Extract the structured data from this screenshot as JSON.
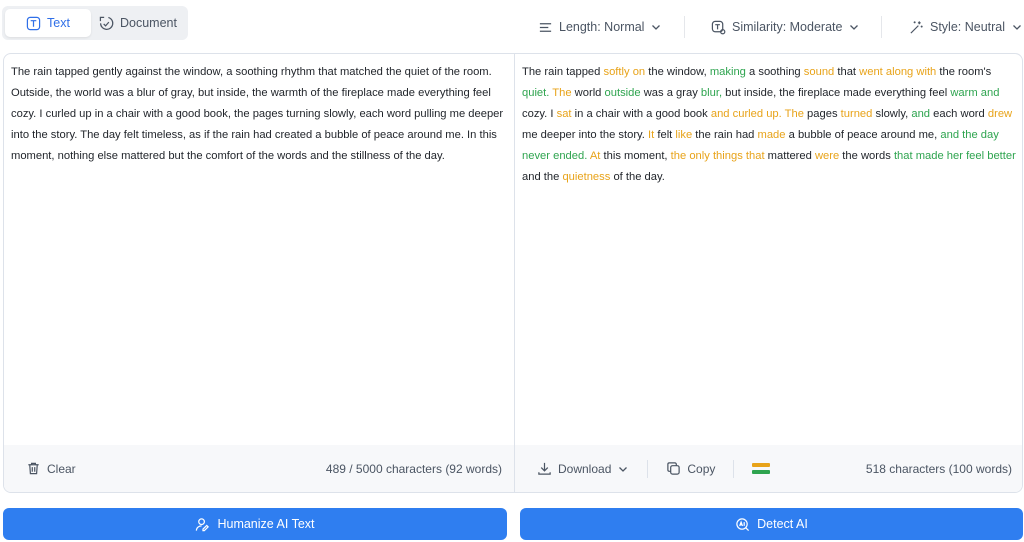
{
  "modes": {
    "text_label": "Text",
    "document_label": "Document"
  },
  "options": {
    "length_label": "Length: Normal",
    "similarity_label": "Similarity: Moderate",
    "style_label": "Style: Neutral"
  },
  "input": {
    "text": "The rain tapped gently against the window, a soothing rhythm that matched the quiet of the room. Outside, the world was a blur of gray, but inside, the warmth of the fireplace made everything feel cozy. I curled up in a chair with a good book, the pages turning slowly, each word pulling me deeper into the story. The day felt timeless, as if the rain had created a bubble of peace around me. In this moment, nothing else mattered but the comfort of the words and the stillness of the day.",
    "clear_label": "Clear",
    "count_label": "489 / 5000 characters (92 words)"
  },
  "output": {
    "segments": [
      {
        "t": "The rain tapped ",
        "c": "n"
      },
      {
        "t": "softly on",
        "c": "o"
      },
      {
        "t": " the window, ",
        "c": "n"
      },
      {
        "t": "making",
        "c": "g"
      },
      {
        "t": " a soothing ",
        "c": "n"
      },
      {
        "t": "sound",
        "c": "o"
      },
      {
        "t": " that ",
        "c": "n"
      },
      {
        "t": "went along with",
        "c": "o"
      },
      {
        "t": " the room's ",
        "c": "n"
      },
      {
        "t": "quiet.",
        "c": "g"
      },
      {
        "t": " ",
        "c": "n"
      },
      {
        "t": "The",
        "c": "o"
      },
      {
        "t": " world ",
        "c": "n"
      },
      {
        "t": "outside",
        "c": "g"
      },
      {
        "t": " was a gray ",
        "c": "n"
      },
      {
        "t": "blur,",
        "c": "g"
      },
      {
        "t": " but inside, the fireplace made everything feel ",
        "c": "n"
      },
      {
        "t": "warm and",
        "c": "g"
      },
      {
        "t": " cozy. I ",
        "c": "n"
      },
      {
        "t": "sat",
        "c": "o"
      },
      {
        "t": " in a chair with a good book ",
        "c": "n"
      },
      {
        "t": "and curled up. The",
        "c": "o"
      },
      {
        "t": " pages ",
        "c": "n"
      },
      {
        "t": "turned",
        "c": "o"
      },
      {
        "t": " slowly, ",
        "c": "n"
      },
      {
        "t": "and",
        "c": "g"
      },
      {
        "t": " each word ",
        "c": "n"
      },
      {
        "t": "drew",
        "c": "o"
      },
      {
        "t": " me deeper into the story. ",
        "c": "n"
      },
      {
        "t": "It",
        "c": "o"
      },
      {
        "t": " felt ",
        "c": "n"
      },
      {
        "t": "like",
        "c": "o"
      },
      {
        "t": " the rain had ",
        "c": "n"
      },
      {
        "t": "made",
        "c": "o"
      },
      {
        "t": " a bubble of peace around me, ",
        "c": "n"
      },
      {
        "t": "and the day never ended.",
        "c": "g"
      },
      {
        "t": " ",
        "c": "n"
      },
      {
        "t": "At",
        "c": "o"
      },
      {
        "t": " this moment, ",
        "c": "n"
      },
      {
        "t": "the only things that",
        "c": "o"
      },
      {
        "t": " mattered ",
        "c": "n"
      },
      {
        "t": "were",
        "c": "o"
      },
      {
        "t": " the words ",
        "c": "n"
      },
      {
        "t": "that made her feel better",
        "c": "g"
      },
      {
        "t": " and the ",
        "c": "n"
      },
      {
        "t": "quietness",
        "c": "o"
      },
      {
        "t": " of the day.",
        "c": "n"
      }
    ],
    "download_label": "Download",
    "copy_label": "Copy",
    "count_label": "518 characters (100 words)"
  },
  "actions": {
    "humanize_label": "Humanize AI Text",
    "detect_label": "Detect AI"
  },
  "colors": {
    "accent": "#2f7ef0",
    "changed_word": "#e8a319",
    "changed_phrase": "#2ea44f"
  }
}
